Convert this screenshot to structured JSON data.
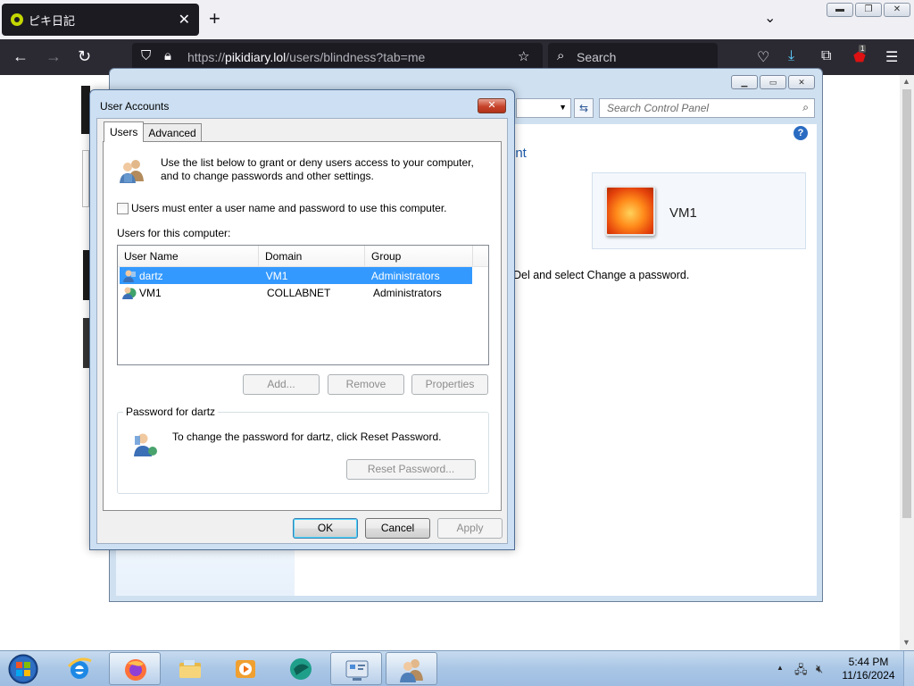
{
  "browser": {
    "tab_title": "ピキ日記",
    "url_prefix": "https://",
    "url_domain": "pikidiary.lol",
    "url_path": "/users/blindness?tab=me",
    "search_placeholder": "Search",
    "extension_badge": "1"
  },
  "control_panel": {
    "search_placeholder": "Search Control Panel",
    "heading_fragment": "unt",
    "user_name": "VM1",
    "text_fragment": "Del and select Change a password."
  },
  "dialog": {
    "title": "User Accounts",
    "tabs": [
      {
        "label": "Users"
      },
      {
        "label": "Advanced"
      }
    ],
    "intro_line1": "Use the list below to grant or deny users access to your computer,",
    "intro_line2": "and to change passwords and other settings.",
    "checkbox_label": "Users must enter a user name and password to use this computer.",
    "users_label": "Users for this computer:",
    "columns": [
      "User Name",
      "Domain",
      "Group"
    ],
    "rows": [
      {
        "name": "dartz",
        "domain": "VM1",
        "group": "Administrators",
        "selected": true
      },
      {
        "name": "VM1",
        "domain": "COLLABNET",
        "group": "Administrators",
        "selected": false
      }
    ],
    "add_label": "Add...",
    "remove_label": "Remove",
    "properties_label": "Properties",
    "password_group_label": "Password for dartz",
    "password_text": "To change the password for dartz, click Reset Password.",
    "reset_label": "Reset Password...",
    "ok_label": "OK",
    "cancel_label": "Cancel",
    "apply_label": "Apply"
  },
  "taskbar": {
    "time": "5:44 PM",
    "date": "11/16/2024"
  }
}
